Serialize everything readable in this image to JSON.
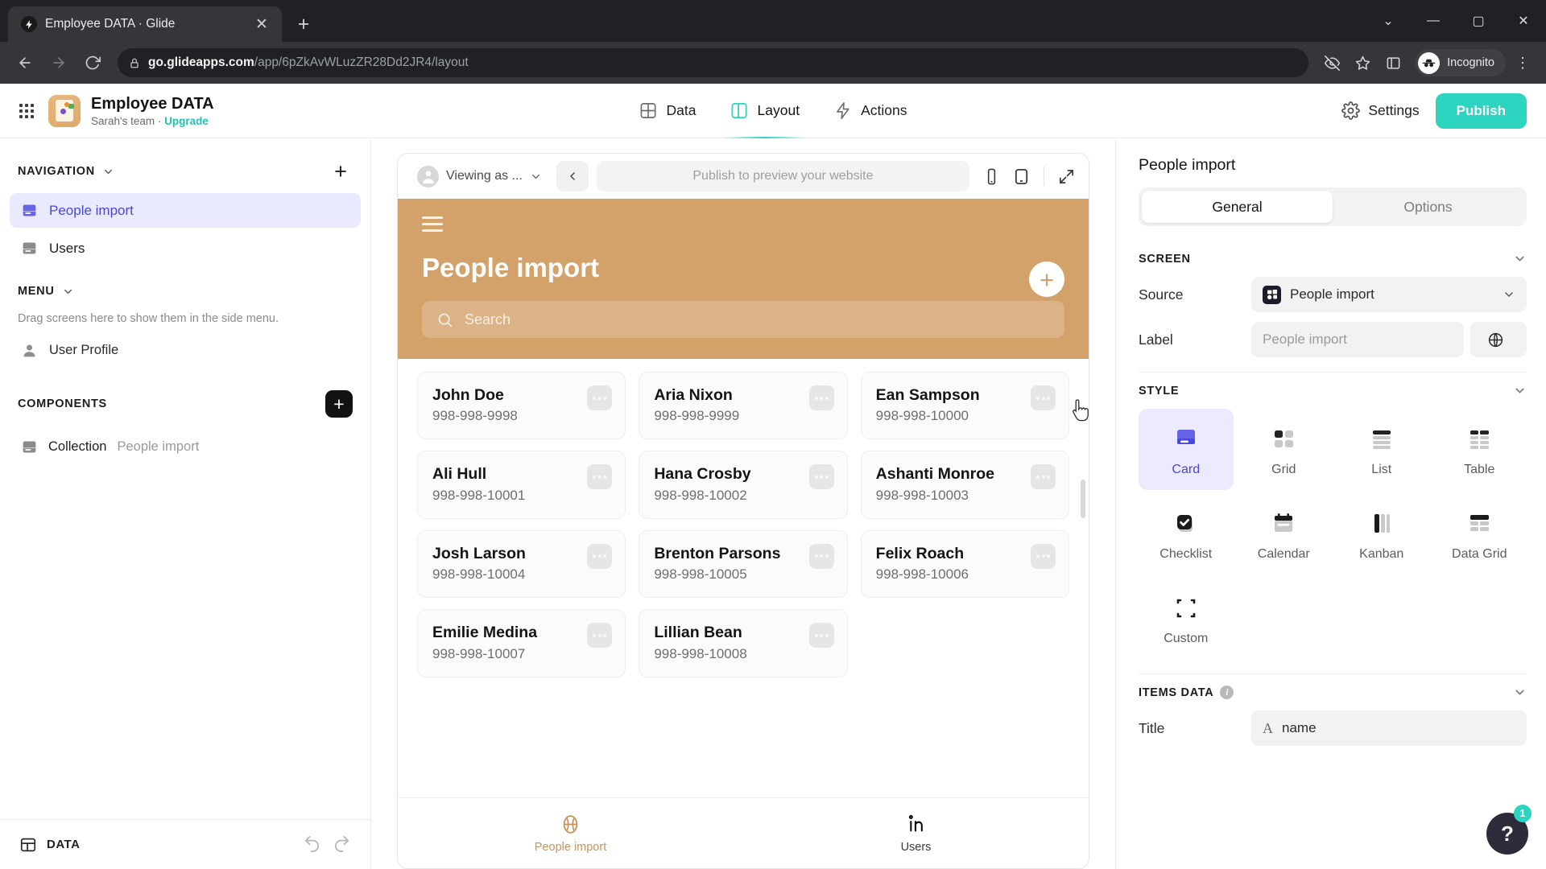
{
  "browser": {
    "tab_title": "Employee DATA · Glide",
    "url_domain": "go.glideapps.com",
    "url_path": "/app/6pZkAvWLuzZR28Dd2JR4/layout",
    "profile_label": "Incognito",
    "icons": {
      "back": "back-arrow-icon",
      "forward": "forward-arrow-icon",
      "reload": "reload-icon",
      "lock": "lock-icon",
      "tracking_protection": "eye-slash-icon",
      "bookmark": "star-icon",
      "side_panel": "side-panel-icon",
      "menu": "kebab-menu-icon"
    }
  },
  "app_header": {
    "title": "Employee DATA",
    "team": "Sarah's team",
    "separator": " · ",
    "upgrade_label": "Upgrade",
    "tabs": [
      {
        "label": "Data",
        "icon": "data-grid-icon",
        "active": false
      },
      {
        "label": "Layout",
        "icon": "layout-panels-icon",
        "active": true
      },
      {
        "label": "Actions",
        "icon": "lightning-bolt-icon",
        "active": false
      }
    ],
    "settings_label": "Settings",
    "publish_label": "Publish",
    "accent_color": "#2dd4bf"
  },
  "sidebar": {
    "navigation_title": "NAVIGATION",
    "navigation_items": [
      {
        "label": "People import",
        "icon": "screen-icon",
        "active": true
      },
      {
        "label": "Users",
        "icon": "screen-icon",
        "active": false
      }
    ],
    "menu_title": "MENU",
    "menu_hint": "Drag screens here to show them in the side menu.",
    "menu_items": [
      {
        "label": "User Profile",
        "icon": "user-avatar-icon"
      }
    ],
    "components_title": "COMPONENTS",
    "components": [
      {
        "name": "Collection",
        "source": "People import",
        "icon": "collection-icon"
      }
    ],
    "footer": {
      "data_label": "DATA",
      "undo_icon": "undo-arrow-icon",
      "redo_icon": "redo-arrow-icon"
    },
    "active_color": "#4a48d6",
    "active_bg": "#eaeaff"
  },
  "preview": {
    "toolbar": {
      "viewing_as": "Viewing as ...",
      "publish_hint": "Publish to preview your website",
      "back_icon": "chevron-left-icon",
      "phone_icon": "mobile-device-icon",
      "tablet_icon": "tablet-device-icon",
      "expand_icon": "expand-diagonal-icon"
    },
    "app": {
      "hero_color": "#d3a16a",
      "menu_icon": "hamburger-menu-icon",
      "title": "People import",
      "add_label": "+",
      "search_placeholder": "Search",
      "cards": [
        {
          "name": "John Doe",
          "phone": "998-998-9998"
        },
        {
          "name": "Aria Nixon",
          "phone": "998-998-9999"
        },
        {
          "name": "Ean Sampson",
          "phone": "998-998-10000"
        },
        {
          "name": "Ali Hull",
          "phone": "998-998-10001"
        },
        {
          "name": "Hana Crosby",
          "phone": "998-998-10002"
        },
        {
          "name": "Ashanti Monroe",
          "phone": "998-998-10003"
        },
        {
          "name": "Josh Larson",
          "phone": "998-998-10004"
        },
        {
          "name": "Brenton Parsons",
          "phone": "998-998-10005"
        },
        {
          "name": "Felix Roach",
          "phone": "998-998-10006"
        },
        {
          "name": "Emilie Medina",
          "phone": "998-998-10007"
        },
        {
          "name": "Lillian Bean",
          "phone": "998-998-10008"
        }
      ],
      "tabbar": [
        {
          "label": "People import",
          "icon": "globe-icon",
          "active": true
        },
        {
          "label": "Users",
          "icon": "linkedin-in-icon",
          "active": false
        }
      ]
    }
  },
  "right_panel": {
    "title": "People import",
    "tabs": [
      {
        "label": "General",
        "active": true
      },
      {
        "label": "Options",
        "active": false
      }
    ],
    "screen": {
      "section_title": "SCREEN",
      "source_label": "Source",
      "source_value": "People import",
      "label_label": "Label",
      "label_value": "People import"
    },
    "style": {
      "section_title": "STYLE",
      "options": [
        {
          "label": "Card",
          "icon": "card-layout-icon",
          "active": true
        },
        {
          "label": "Grid",
          "icon": "grid-layout-icon",
          "active": false
        },
        {
          "label": "List",
          "icon": "list-layout-icon",
          "active": false
        },
        {
          "label": "Table",
          "icon": "table-layout-icon",
          "active": false
        },
        {
          "label": "Checklist",
          "icon": "checklist-icon",
          "active": false
        },
        {
          "label": "Calendar",
          "icon": "calendar-icon",
          "active": false
        },
        {
          "label": "Kanban",
          "icon": "kanban-icon",
          "active": false
        },
        {
          "label": "Data Grid",
          "icon": "data-grid-layout-icon",
          "active": false
        },
        {
          "label": "Custom",
          "icon": "custom-frame-icon",
          "active": false
        }
      ]
    },
    "items_data": {
      "section_title": "ITEMS DATA",
      "title_label": "Title",
      "title_value": "name",
      "title_type_icon": "text-type-icon"
    },
    "help": {
      "glyph": "?",
      "badge": "1"
    },
    "active_color": "#4a48d6"
  }
}
